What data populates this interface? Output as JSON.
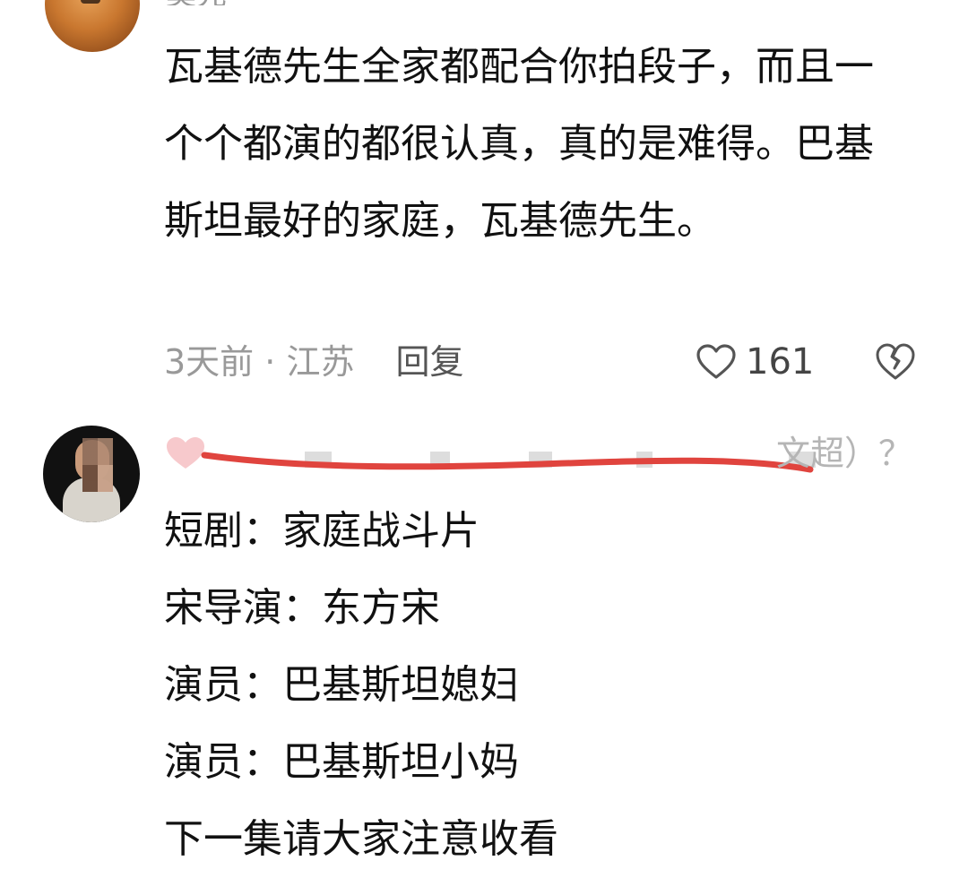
{
  "comments": [
    {
      "username_fragment": "莫先",
      "text": "瓦基德先生全家都配合你拍段子，而且一个个都演的都很认真，真的是难得。巴基斯坦最好的家庭，瓦基德先生。",
      "time": "3天前",
      "separator": " · ",
      "location": "江苏",
      "reply_label": "回复",
      "likes": "161"
    },
    {
      "username_tail": "文超）？",
      "lines": [
        "短剧：家庭战斗片",
        "宋导演：东方宋",
        "演员：巴基斯坦媳妇",
        "演员：巴基斯坦小妈",
        "下一集请大家注意收看"
      ]
    }
  ],
  "icons": {
    "like": "heart-outline-icon",
    "dislike": "broken-heart-icon",
    "badge": "pink-heart-icon"
  },
  "colors": {
    "text": "#111111",
    "meta": "#999999",
    "redline": "#e0443e",
    "pink_heart": "#f7c9cc"
  }
}
